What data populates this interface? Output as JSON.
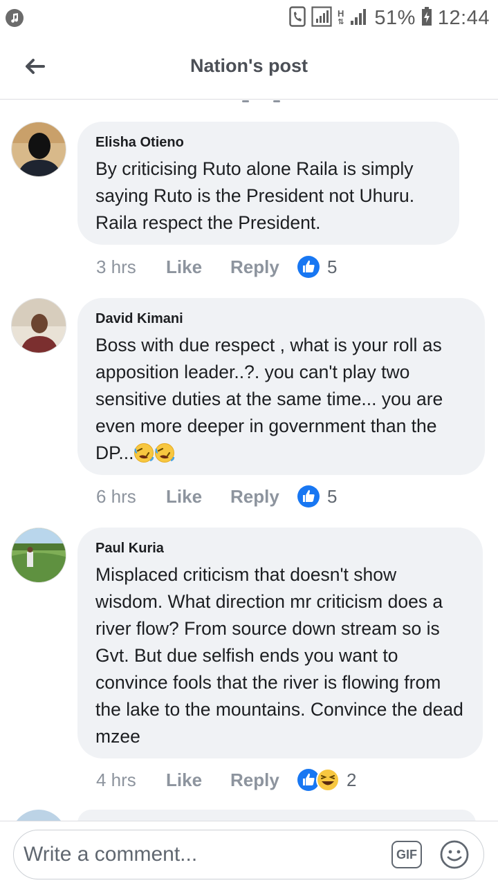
{
  "status_bar": {
    "battery": "51%",
    "time": "12:44",
    "network": "H"
  },
  "header": {
    "title": "Nation's post"
  },
  "comments": [
    {
      "author": "Elisha Otieno",
      "text": "By criticising Ruto alone Raila is simply saying Ruto is the President not Uhuru. Raila  respect  the President.",
      "time": "3 hrs",
      "like_label": "Like",
      "reply_label": "Reply",
      "reactions": [
        "like"
      ],
      "reaction_count": "5"
    },
    {
      "author": "David Kimani",
      "text": "Boss with due respect , what is your roll as apposition leader..?. you can't play two sensitive duties at the same time... you are even  more deeper  in government than the DP...",
      "emojis": [
        "rolling-on-floor-laughing",
        "rolling-on-floor-laughing"
      ],
      "time": "6 hrs",
      "like_label": "Like",
      "reply_label": "Reply",
      "reactions": [
        "like"
      ],
      "reaction_count": "5"
    },
    {
      "author": "Paul Kuria",
      "text": "Misplaced criticism that doesn't show wisdom. What direction mr criticism does a river flow? From source down stream so is Gvt. But due selfish ends you want to convince fools that the river is flowing from the lake to the mountains. Convince the dead mzee",
      "time": "4 hrs",
      "like_label": "Like",
      "reply_label": "Reply",
      "reactions": [
        "like",
        "haha"
      ],
      "reaction_count": "2"
    }
  ],
  "composer": {
    "placeholder": "Write a comment...",
    "gif_label": "GIF"
  },
  "colors": {
    "bubble": "#f0f2f5",
    "like_blue": "#1877f2",
    "haha_yellow": "#f7c740",
    "muted_text": "#8d949e"
  }
}
